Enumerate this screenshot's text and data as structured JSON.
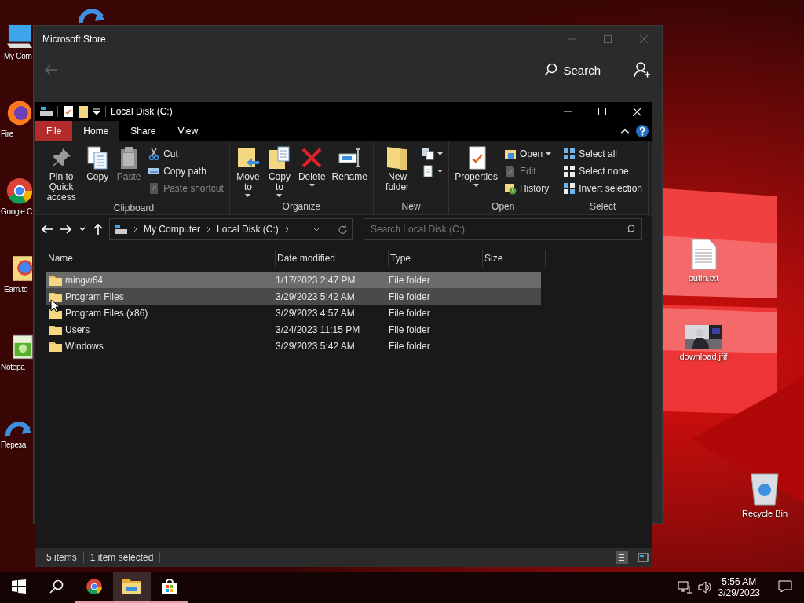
{
  "desktop": {
    "left_icons": [
      {
        "kind": "computer",
        "label": "My Com"
      },
      {
        "kind": "firefox",
        "label": "Fire"
      },
      {
        "kind": "chrome",
        "label": "Google C"
      },
      {
        "kind": "shortcut-folder",
        "label": "Earn.to"
      },
      {
        "kind": "notepad",
        "label": "Notepa"
      },
      {
        "kind": "refresh",
        "label": "Переза"
      }
    ],
    "top_icons": [
      {
        "kind": "refresh"
      }
    ],
    "right_icons": [
      {
        "kind": "text-file",
        "label": "putin.txt"
      },
      {
        "kind": "picture",
        "label": "download.jfif"
      },
      {
        "kind": "recycle-bin",
        "label": "Recycle Bin"
      }
    ]
  },
  "store_window": {
    "title": "Microsoft Store",
    "search": "Search"
  },
  "explorer": {
    "title": "Local Disk (C:)",
    "tabs": [
      {
        "label": "File",
        "kind": "menu",
        "selected": false
      },
      {
        "label": "Home",
        "kind": "tab",
        "selected": true
      },
      {
        "label": "Share",
        "kind": "tab",
        "selected": false
      },
      {
        "label": "View",
        "kind": "tab",
        "selected": false
      }
    ],
    "ribbon": [
      {
        "label": "Clipboard",
        "items": [
          {
            "kind": "large",
            "label": "Pin to Quick access",
            "disabled": false
          },
          {
            "kind": "large",
            "label": "Copy",
            "disabled": false
          },
          {
            "kind": "large",
            "label": "Paste",
            "disabled": true
          },
          {
            "kind": "stack",
            "entries": [
              {
                "label": "Cut",
                "disabled": false
              },
              {
                "label": "Copy path",
                "disabled": false
              },
              {
                "label": "Paste shortcut",
                "disabled": true
              }
            ]
          }
        ]
      },
      {
        "label": "Organize",
        "items": [
          {
            "kind": "large",
            "label": "Move to",
            "dropdown": true,
            "disabled": false
          },
          {
            "kind": "large",
            "label": "Copy to",
            "dropdown": true,
            "disabled": false
          },
          {
            "kind": "large",
            "label": "Delete",
            "dropdown": true,
            "disabled": false
          },
          {
            "kind": "large",
            "label": "Rename",
            "disabled": false
          }
        ]
      },
      {
        "label": "New",
        "items": [
          {
            "kind": "large",
            "label": "New folder",
            "disabled": false
          },
          {
            "kind": "stack",
            "entries": [
              {
                "dropdown": true,
                "disabled": false
              },
              {
                "dropdown": true,
                "disabled": false
              }
            ]
          }
        ]
      },
      {
        "label": "Open",
        "items": [
          {
            "kind": "large",
            "label": "Properties",
            "dropdown": true,
            "disabled": false
          },
          {
            "kind": "stack",
            "entries": [
              {
                "label": "Open",
                "dropdown": true,
                "disabled": false
              },
              {
                "label": "Edit",
                "disabled": true
              },
              {
                "label": "History",
                "disabled": false
              }
            ]
          }
        ]
      },
      {
        "label": "Select",
        "items": [
          {
            "kind": "stack",
            "entries": [
              {
                "label": "Select all",
                "disabled": false
              },
              {
                "label": "Select none",
                "disabled": false
              },
              {
                "label": "Invert selection",
                "disabled": false
              }
            ]
          }
        ]
      }
    ],
    "breadcrumb": [
      "My Computer",
      "Local Disk (C:)"
    ],
    "search_placeholder": "Search Local Disk (C:)",
    "columns": [
      "Name",
      "Date modified",
      "Type",
      "Size"
    ],
    "rows": [
      {
        "name": "mingw64",
        "date": "1/17/2023 2:47 PM",
        "type": "File folder",
        "selected": true,
        "hovered": false
      },
      {
        "name": "Program Files",
        "date": "3/29/2023 5:42 AM",
        "type": "File folder",
        "selected": false,
        "hovered": true
      },
      {
        "name": "Program Files (x86)",
        "date": "3/29/2023 4:57 AM",
        "type": "File folder",
        "selected": false,
        "hovered": false
      },
      {
        "name": "Users",
        "date": "3/24/2023 11:15 PM",
        "type": "File folder",
        "selected": false,
        "hovered": false
      },
      {
        "name": "Windows",
        "date": "3/29/2023 5:42 AM",
        "type": "File folder",
        "selected": false,
        "hovered": false
      }
    ],
    "status": [
      "5 items",
      "1 item selected"
    ],
    "views": [
      {
        "kind": "details",
        "selected": true
      },
      {
        "kind": "tiles",
        "selected": false
      }
    ]
  },
  "taskbar": {
    "apps": [
      {
        "kind": "chrome",
        "active": false
      },
      {
        "kind": "explorer",
        "active": true
      },
      {
        "kind": "store",
        "active": false
      }
    ],
    "time": "5:56 AM",
    "date": "3/29/2023"
  }
}
